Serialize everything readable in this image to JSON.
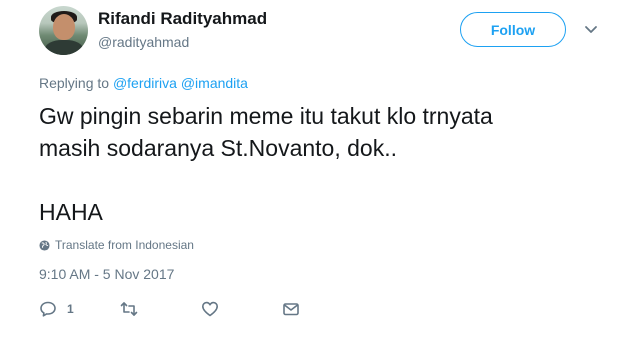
{
  "user": {
    "name": "Rifandi Radityahmad",
    "handle": "@radityahmad"
  },
  "follow_button": {
    "label": "Follow"
  },
  "replying": {
    "prefix": "Replying to",
    "mentions": [
      "@ferdiriva",
      "@imandita"
    ]
  },
  "tweet": {
    "lines": [
      "Gw pingin sebarin meme itu takut klo trnyata",
      "masih sodaranya St.Novanto, dok.."
    ],
    "last_line": "HAHA"
  },
  "translate": {
    "label": "Translate from Indonesian"
  },
  "timestamp": "9:10 AM - 5 Nov 2017",
  "actions": {
    "reply_count": "1"
  },
  "colors": {
    "accent": "#1da1f2",
    "muted": "#657786",
    "text": "#14171a"
  }
}
